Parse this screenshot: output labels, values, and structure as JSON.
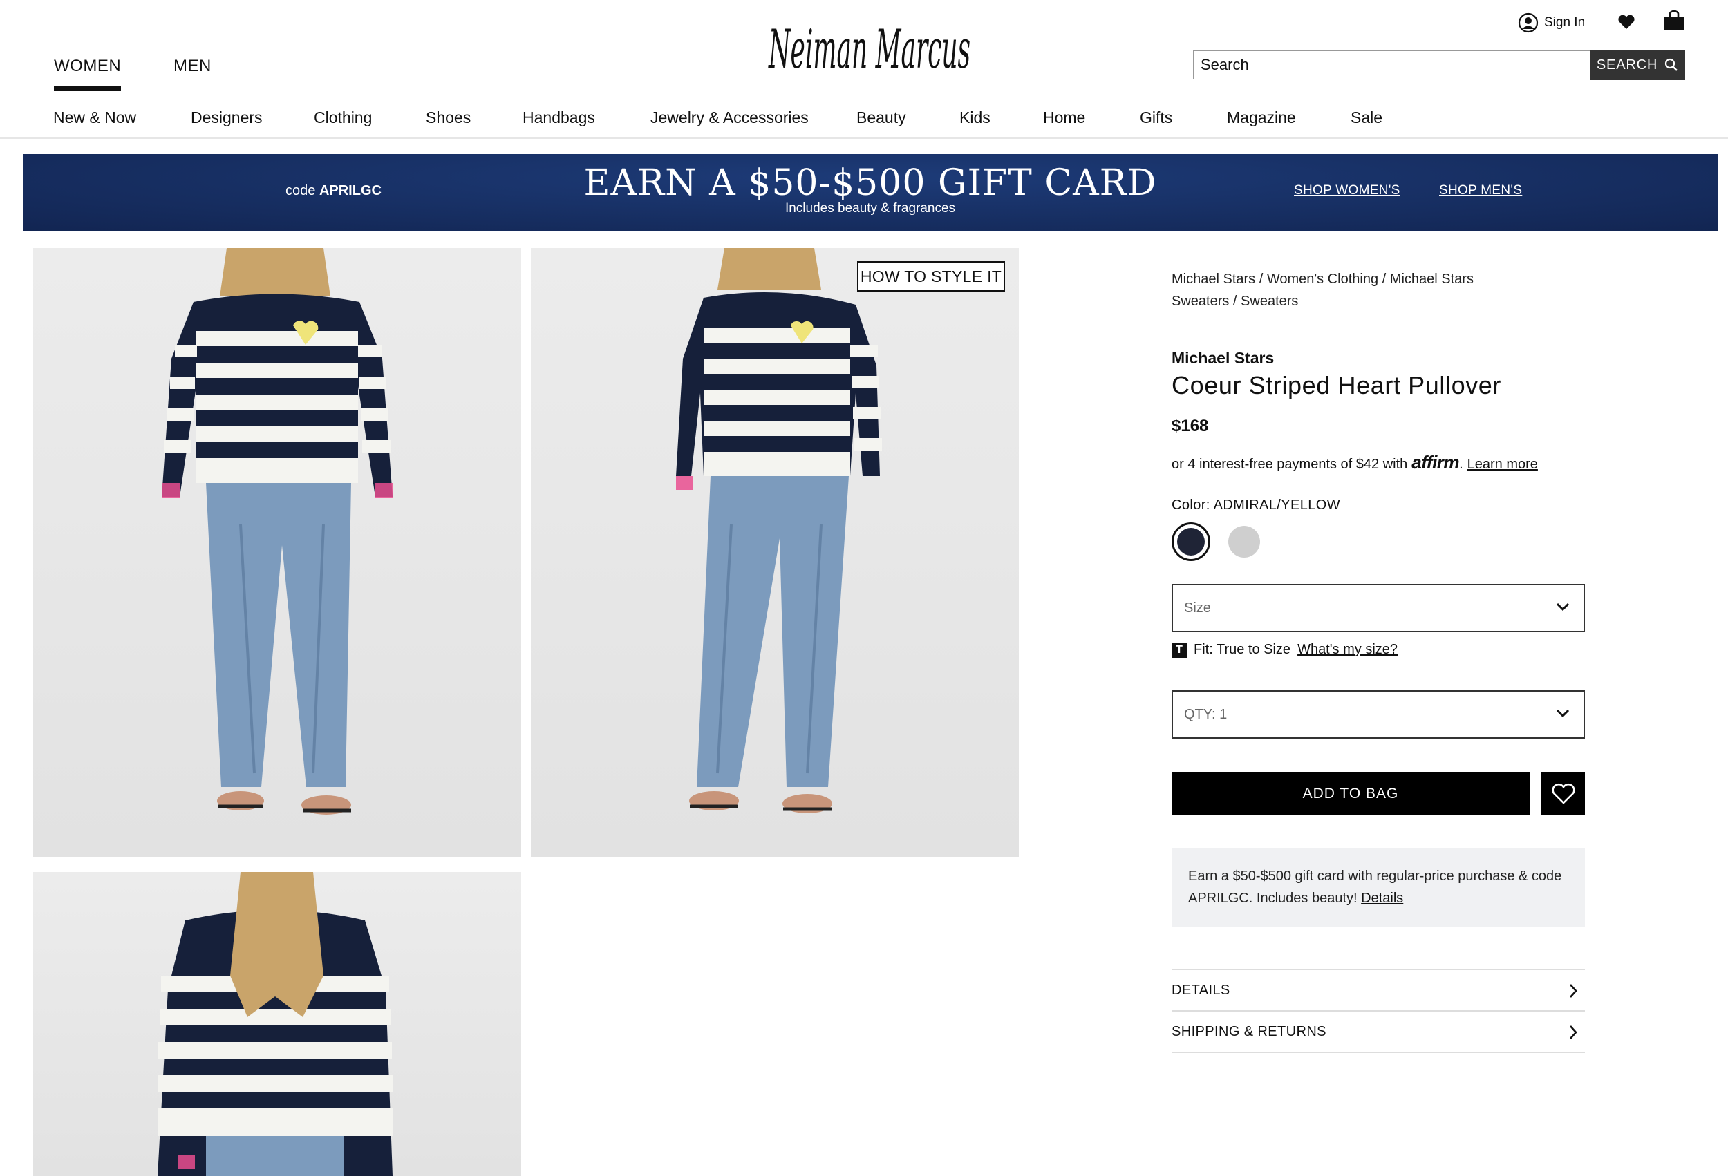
{
  "header": {
    "gender_tabs": [
      {
        "label": "WOMEN",
        "active": true
      },
      {
        "label": "MEN",
        "active": false
      }
    ],
    "logo_text": "Neiman Marcus",
    "sign_in": "Sign In",
    "search": {
      "value": "Search",
      "button": "SEARCH"
    }
  },
  "nav": [
    "New & Now",
    "Designers",
    "Clothing",
    "Shoes",
    "Handbags",
    "Jewelry & Accessories",
    "Beauty",
    "Kids",
    "Home",
    "Gifts",
    "Magazine",
    "Sale"
  ],
  "banner": {
    "code_prefix": "code",
    "code": "APRILGC",
    "headline": "EARN A $50-$500 GIFT CARD",
    "subline": "Includes beauty & fragrances",
    "link_women": "SHOP WOMEN'S",
    "link_men": "SHOP MEN'S",
    "bg_color": "#172f63"
  },
  "gallery": {
    "style_button": "HOW TO STYLE IT"
  },
  "product": {
    "breadcrumb": "Michael Stars / Women's Clothing / Michael Stars Sweaters / Sweaters",
    "brand": "Michael Stars",
    "name": "Coeur Striped Heart Pullover",
    "price": "$168",
    "affirm": {
      "prefix": "or 4 interest-free payments of $42 with",
      "logo": "affirm",
      "suffix": ".",
      "link": "Learn more"
    },
    "color_label": "Color: ADMIRAL/YELLOW",
    "swatches": [
      {
        "name": "admiral",
        "color": "#1f2436",
        "selected": true
      },
      {
        "name": "grey",
        "color": "#cfcfcf",
        "selected": false
      }
    ],
    "size_placeholder": "Size",
    "fit": {
      "icon": "T",
      "text": "Fit: True to Size",
      "link": "What's my size?"
    },
    "qty": "QTY: 1",
    "add_to_bag": "ADD TO BAG",
    "promo": {
      "text": "Earn a $50-$500 gift card with regular-price purchase & code APRILGC. Includes beauty!",
      "link": "Details"
    },
    "accordions": [
      "DETAILS",
      "SHIPPING & RETURNS"
    ]
  }
}
